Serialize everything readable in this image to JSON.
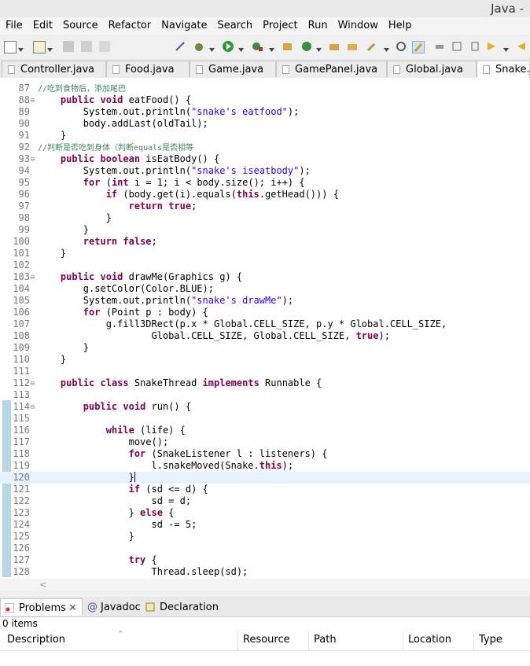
{
  "window": {
    "title": "Java -"
  },
  "menu": [
    "File",
    "Edit",
    "Source",
    "Refactor",
    "Navigate",
    "Search",
    "Project",
    "Run",
    "Window",
    "Help"
  ],
  "tabs": [
    {
      "label": "Controller.java",
      "active": false
    },
    {
      "label": "Food.java",
      "active": false
    },
    {
      "label": "Game.java",
      "active": false
    },
    {
      "label": "GamePanel.java",
      "active": false
    },
    {
      "label": "Global.java",
      "active": false
    },
    {
      "label": "Snake.ja",
      "active": true
    }
  ],
  "editor": {
    "current_line": 120,
    "lines": [
      {
        "n": "87",
        "code": "//吃到食物后，添加尾巴",
        "fold": false
      },
      {
        "n": "88",
        "code": "    public void eatFood() {",
        "fold": true
      },
      {
        "n": "89",
        "code": "        System.out.println(\"snake's eatfood\");",
        "fold": false
      },
      {
        "n": "90",
        "code": "        body.addLast(oldTail);",
        "fold": false
      },
      {
        "n": "91",
        "code": "    }",
        "fold": false
      },
      {
        "n": "92",
        "code": "//判断是否吃到身体（判断equals是否相等",
        "fold": false
      },
      {
        "n": "93",
        "code": "    public boolean isEatBody() {",
        "fold": true
      },
      {
        "n": "94",
        "code": "        System.out.println(\"snake's iseatbody\");",
        "fold": false
      },
      {
        "n": "95",
        "code": "        for (int i = 1; i < body.size(); i++) {",
        "fold": false
      },
      {
        "n": "96",
        "code": "            if (body.get(i).equals(this.getHead())) {",
        "fold": false
      },
      {
        "n": "97",
        "code": "                return true;",
        "fold": false
      },
      {
        "n": "98",
        "code": "            }",
        "fold": false
      },
      {
        "n": "99",
        "code": "        }",
        "fold": false
      },
      {
        "n": "100",
        "code": "        return false;",
        "fold": false
      },
      {
        "n": "101",
        "code": "    }",
        "fold": false
      },
      {
        "n": "102",
        "code": "",
        "fold": false
      },
      {
        "n": "103",
        "code": "    public void drawMe(Graphics g) {",
        "fold": true
      },
      {
        "n": "104",
        "code": "        g.setColor(Color.BLUE);",
        "fold": false
      },
      {
        "n": "105",
        "code": "        System.out.println(\"snake's drawMe\");",
        "fold": false
      },
      {
        "n": "106",
        "code": "        for (Point p : body) {",
        "fold": false
      },
      {
        "n": "107",
        "code": "            g.fill3DRect(p.x * Global.CELL_SIZE, p.y * Global.CELL_SIZE,",
        "fold": false
      },
      {
        "n": "108",
        "code": "                    Global.CELL_SIZE, Global.CELL_SIZE, true);",
        "fold": false
      },
      {
        "n": "109",
        "code": "        }",
        "fold": false
      },
      {
        "n": "110",
        "code": "    }",
        "fold": false
      },
      {
        "n": "111",
        "code": "",
        "fold": false
      },
      {
        "n": "112",
        "code": "    public class SnakeThread implements Runnable {",
        "fold": true
      },
      {
        "n": "113",
        "code": "",
        "fold": false
      },
      {
        "n": "114",
        "code": "        public void run() {",
        "fold": true
      },
      {
        "n": "115",
        "code": "",
        "fold": false
      },
      {
        "n": "116",
        "code": "            while (life) {",
        "fold": false
      },
      {
        "n": "117",
        "code": "                move();",
        "fold": false
      },
      {
        "n": "118",
        "code": "                for (SnakeListener l : listeners) {",
        "fold": false
      },
      {
        "n": "119",
        "code": "                    l.snakeMoved(Snake.this);",
        "fold": false
      },
      {
        "n": "120",
        "code": "                }",
        "fold": false
      },
      {
        "n": "121",
        "code": "                if (sd <= d) {",
        "fold": false
      },
      {
        "n": "122",
        "code": "                    sd = d;",
        "fold": false
      },
      {
        "n": "123",
        "code": "                } else {",
        "fold": false
      },
      {
        "n": "124",
        "code": "                    sd -= 5;",
        "fold": false
      },
      {
        "n": "125",
        "code": "                }",
        "fold": false
      },
      {
        "n": "126",
        "code": "",
        "fold": false
      },
      {
        "n": "127",
        "code": "                try {",
        "fold": false
      },
      {
        "n": "128",
        "code": "                    Thread.sleep(sd);",
        "fold": false
      }
    ]
  },
  "bottom_panel": {
    "tabs": [
      {
        "label": "Problems",
        "active": true,
        "closable": true
      },
      {
        "label": "Javadoc",
        "active": false,
        "closable": false
      },
      {
        "label": "Declaration",
        "active": false,
        "closable": false
      }
    ],
    "status": "0 items",
    "columns": [
      "Description",
      "Resource",
      "Path",
      "Location",
      "Type"
    ]
  },
  "colors": {
    "keyword": "#7f0055",
    "string": "#2a00ff",
    "comment": "#3f7f5f",
    "current_line": "#e8f2fe"
  }
}
